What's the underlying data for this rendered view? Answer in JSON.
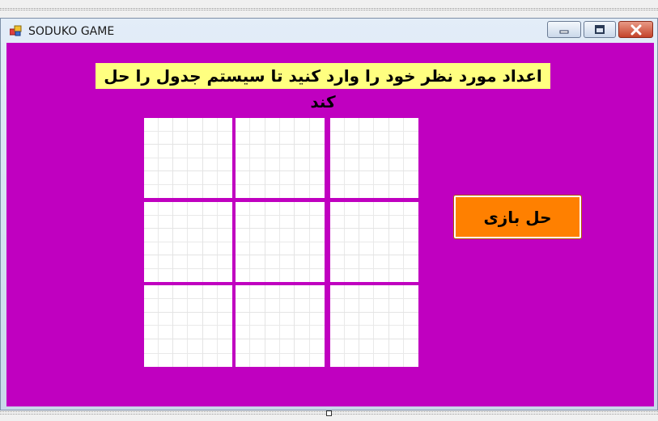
{
  "window": {
    "title": "SODUKO GAME",
    "icon": "form-icon",
    "controls": [
      "minimize-icon",
      "maximize-icon",
      "close-icon"
    ]
  },
  "form": {
    "instruction": "اعداد مورد نظر خود را وارد کنید تا سیستم جدول را حل کند",
    "solve_button": "حل بازی"
  },
  "colors": {
    "client_background": "#c000c0",
    "instruction_background": "#ffff80",
    "solve_button_background": "#ff8000",
    "cell_background": "#ffffff"
  },
  "sudoku": {
    "boxes": 9,
    "cells_per_box": 9,
    "values": []
  }
}
